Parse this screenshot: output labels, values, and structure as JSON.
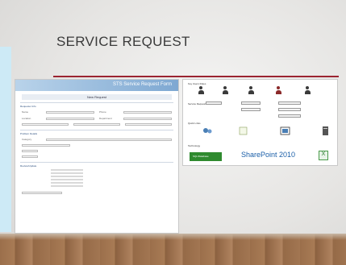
{
  "slide": {
    "title": "SERVICE REQUEST"
  },
  "form": {
    "header_title": "STS Service Request Form",
    "subheader": "New Request",
    "section_labels": [
      "Requester Info",
      "Problem Details",
      "Review/Update"
    ],
    "fields": [
      {
        "label": "Name",
        "value": ""
      },
      {
        "label": "Phone",
        "value": ""
      },
      {
        "label": "Location",
        "value": ""
      },
      {
        "label": "Department",
        "value": ""
      },
      {
        "label": "Category",
        "value": ""
      }
    ],
    "list_count": 6
  },
  "dashboard": {
    "top_label": "Key Users Roles",
    "mid_label": "Service Requests",
    "tools_label": "Quick Links",
    "tech_label": "Technology",
    "tech_items": [
      "SQL/Database",
      "SharePoint 2010",
      "X"
    ]
  },
  "colors": {
    "accent": "#9b2431",
    "sidebar": "#cdeaf6",
    "header_blue": "#7ea8d2",
    "sharepoint": "#1b5fa8",
    "green": "#2f8a2f"
  }
}
